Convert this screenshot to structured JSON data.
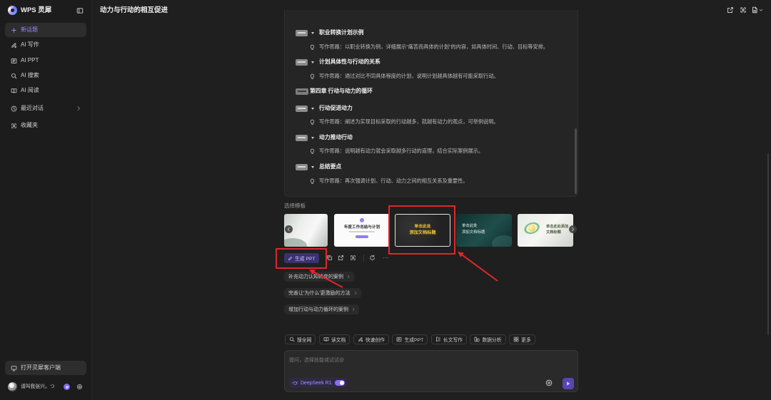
{
  "app": {
    "name": "WPS 灵犀"
  },
  "colors": {
    "accent": "#8b6cf6",
    "annotation": "#e0262b",
    "background": "#1f1f1f",
    "template_title_yellow": "#f0c430"
  },
  "sidebar": {
    "toggle_icon": "sidebar-toggle-icon",
    "new_topic": {
      "icon": "plus-icon",
      "label": "新话题"
    },
    "nav": [
      {
        "icon": "pen-icon",
        "label": "AI 写作"
      },
      {
        "icon": "ppt-icon",
        "label": "AI PPT"
      },
      {
        "icon": "search-icon",
        "label": "AI 搜索"
      },
      {
        "icon": "book-icon",
        "label": "AI 阅读"
      }
    ],
    "recent": {
      "icon": "clock-icon",
      "label": "最近对话"
    },
    "favorites": {
      "icon": "bookmark-icon",
      "label": "收藏夹"
    },
    "open_client": {
      "icon": "monitor-icon",
      "label": "打开灵犀客户端"
    },
    "user": {
      "name": "请叫我张兴。つ",
      "icons": [
        "avatar",
        "theme-icon",
        "gear-icon"
      ]
    }
  },
  "header": {
    "title": "动力与行动的相互促进",
    "icons": [
      "share-icon",
      "bookmark-icon",
      "document-icon",
      "chevron-down-icon"
    ]
  },
  "outline": {
    "items": [
      {
        "title": "职业转换计划示例",
        "note": "写作思路：以职业转换为例，详细展示“痛苦而具体的计划”的内容，如具体时间、行动、目标等安排。"
      },
      {
        "title": "计划具体性与行动的关系",
        "note": "写作思路：通过对比不同具体程度的计划，说明计划越具体越有可能采取行动。"
      },
      {
        "title": "第四章 行动与动力的循环"
      },
      {
        "title": "行动促进动力",
        "note": "写作思路：阐述为实现目标采取的行动越多，就越有动力的观点，可举例说明。"
      },
      {
        "title": "动力推动行动",
        "note": "写作思路：说明越有动力就会采取越多行动的道理，结合实际案例展示。"
      },
      {
        "title": "总结要点",
        "note": "写作思路：再次强调计划、行动、动力之间的相互关系及重要性。"
      }
    ]
  },
  "templates": {
    "label": "选择模板",
    "selected_index": 2,
    "items": [
      {
        "lines": []
      },
      {
        "lines": [
          "年度工作总结与计划"
        ]
      },
      {
        "lines": [
          "单击此处",
          "添加文档标题"
        ]
      },
      {
        "lines": [
          "单击此处",
          "添加文档标题"
        ]
      },
      {
        "lines": [
          "单击此处添加",
          "文档标题"
        ]
      }
    ],
    "nav_icons": [
      "chevron-left-icon",
      "chevron-right-icon"
    ]
  },
  "actions": {
    "generate_ppt": {
      "icon": "pencil-icon",
      "label": "生成 PPT"
    },
    "icons": [
      "copy-icon",
      "share-icon",
      "bookmark-icon",
      "refresh-icon",
      "more-icon"
    ]
  },
  "suggestions": [
    "补充动力认知转变的案例",
    "完善让'为什么'更激励的方法",
    "增加行动与动力循环的案例"
  ],
  "tools": [
    {
      "icon": "search-icon",
      "label": "搜全网"
    },
    {
      "icon": "document-icon",
      "label": "读文档"
    },
    {
      "icon": "magic-pen-icon",
      "label": "快速创作"
    },
    {
      "icon": "ppt-icon",
      "label": "生成PPT"
    },
    {
      "icon": "long-text-icon",
      "label": "长文写作"
    },
    {
      "icon": "data-analysis-icon",
      "label": "数据分析"
    },
    {
      "icon": "grid-icon",
      "label": "更多"
    }
  ],
  "input": {
    "placeholder": "提问，选择技能或试试@",
    "model": {
      "icon": "deepseek-whale-icon",
      "label": "DeepSeek R1",
      "enabled": true
    },
    "icons": [
      "plus-circle-icon",
      "send-icon"
    ]
  }
}
